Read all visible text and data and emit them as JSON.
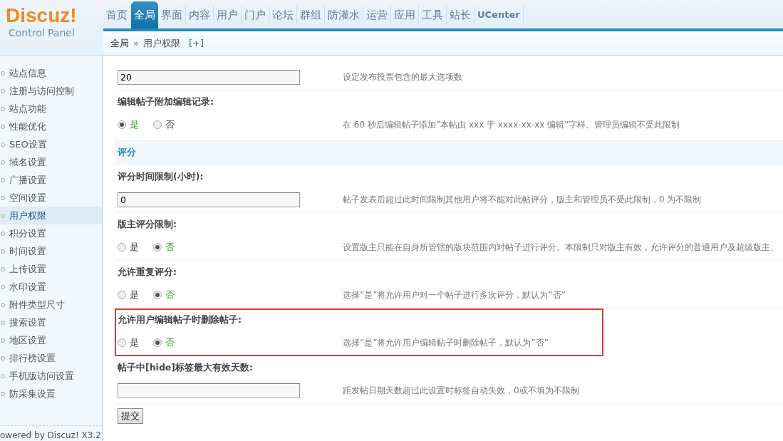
{
  "logo": {
    "title": "Discuz!",
    "subtitle": "Control Panel"
  },
  "nav": [
    {
      "label": "首页",
      "selected": false
    },
    {
      "label": "全局",
      "selected": true
    },
    {
      "label": "界面",
      "selected": false
    },
    {
      "label": "内容",
      "selected": false
    },
    {
      "label": "用户",
      "selected": false
    },
    {
      "label": "门户",
      "selected": false
    },
    {
      "label": "论坛",
      "selected": false
    },
    {
      "label": "群组",
      "selected": false
    },
    {
      "label": "防灌水",
      "selected": false
    },
    {
      "label": "运营",
      "selected": false
    },
    {
      "label": "应用",
      "selected": false
    },
    {
      "label": "工具",
      "selected": false
    },
    {
      "label": "站长",
      "selected": false
    },
    {
      "label": "UCenter",
      "selected": false
    }
  ],
  "breadcrumb": {
    "parent": "全局",
    "separator": "»",
    "current": "用户权限",
    "add": "[+]"
  },
  "sidebar": {
    "items": [
      {
        "label": "站点信息",
        "selected": false
      },
      {
        "label": "注册与访问控制",
        "selected": false
      },
      {
        "label": "站点功能",
        "selected": false
      },
      {
        "label": "性能优化",
        "selected": false
      },
      {
        "label": "SEO设置",
        "selected": false
      },
      {
        "label": "域名设置",
        "selected": false
      },
      {
        "label": "广播设置",
        "selected": false
      },
      {
        "label": "空间设置",
        "selected": false
      },
      {
        "label": "用户权限",
        "selected": true
      },
      {
        "label": "积分设置",
        "selected": false
      },
      {
        "label": "时间设置",
        "selected": false
      },
      {
        "label": "上传设置",
        "selected": false
      },
      {
        "label": "水印设置",
        "selected": false
      },
      {
        "label": "附件类型尺寸",
        "selected": false
      },
      {
        "label": "搜索设置",
        "selected": false
      },
      {
        "label": "地区设置",
        "selected": false
      },
      {
        "label": "排行榜设置",
        "selected": false
      },
      {
        "label": "手机版访问设置",
        "selected": false
      },
      {
        "label": "防采集设置",
        "selected": false
      }
    ],
    "footer": {
      "prefix": "owered by",
      "link": "Discuz!",
      "version": "X3.2"
    }
  },
  "settings": [
    {
      "kind": "text",
      "value": "20",
      "hint": "设定发布投票包含的最大选项数",
      "highlighted": false
    },
    {
      "kind": "radio",
      "label": "编辑帖子附加编辑记录:",
      "options": [
        {
          "label": "是",
          "selected": true
        },
        {
          "label": "否",
          "selected": false
        }
      ],
      "hint": "在 60 秒后编辑帖子添加”本帖由 xxx 于 xxxx-xx-xx 编辑”字样。管理员编辑不受此限制",
      "highlighted": false
    },
    {
      "kind": "section",
      "label": "评分"
    },
    {
      "kind": "text",
      "label": "评分时间限制(小时):",
      "value": "0",
      "hint": "帖子发表后超过此时间限制其他用户将不能对此帖评分，版主和管理员不受此限制，0 为不限制",
      "highlighted": false
    },
    {
      "kind": "radio",
      "label": "版主评分限制:",
      "options": [
        {
          "label": "是",
          "selected": false
        },
        {
          "label": "否",
          "selected": true
        }
      ],
      "hint": "设置版主只能在自身所管辖的版块范围内对帖子进行评分。本限制只对版主有效，允许评分的普通用户及超级版主、",
      "highlighted": false
    },
    {
      "kind": "radio",
      "label": "允许重复评分:",
      "options": [
        {
          "label": "是",
          "selected": false
        },
        {
          "label": "否",
          "selected": true
        }
      ],
      "hint": "选择”是”将允许用户对一个帖子进行多次评分，默认为”否”",
      "highlighted": false
    },
    {
      "kind": "radio",
      "label": "允许用户编辑帖子时删除帖子:",
      "options": [
        {
          "label": "是",
          "selected": false
        },
        {
          "label": "否",
          "selected": true
        }
      ],
      "hint": "选择”是”将允许用户编辑帖子时删除帖子，默认为”否”",
      "highlighted": true
    },
    {
      "kind": "text",
      "label": "帖子中[hide]标签最大有效天数:",
      "hint": "距发帖日期天数超过此设置时标签自动失效，0或不填为不限制",
      "highlighted": false
    }
  ],
  "submit": "提交"
}
